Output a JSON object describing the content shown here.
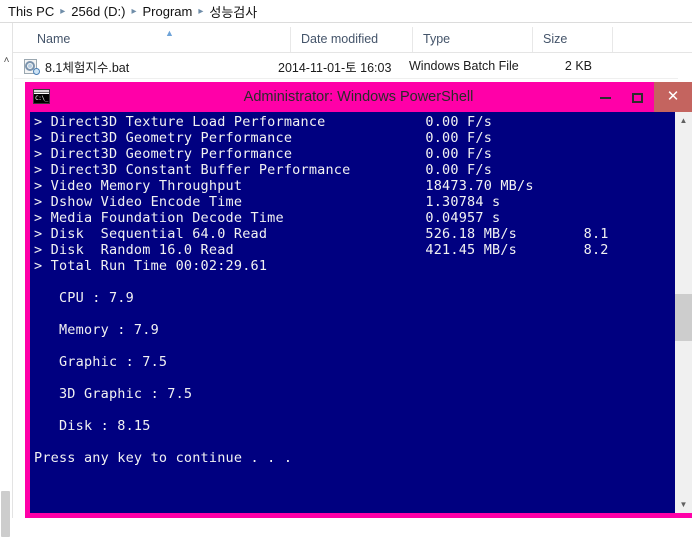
{
  "explorer": {
    "breadcrumb": {
      "name": "address-breadcrumb",
      "separator": "▸",
      "items": [
        "This PC",
        "256d (D:)",
        "Program",
        "성능검사"
      ]
    },
    "columns": {
      "name": "Name",
      "date_modified": "Date modified",
      "type": "Type",
      "size": "Size",
      "sort_glyph": "▲"
    },
    "nav": {
      "collapse_glyph": "˄"
    },
    "files": [
      {
        "name": "8.1체험지수.bat",
        "date_modified": "2014-11-01-토 16:03",
        "type": "Windows Batch File",
        "size": "2 KB",
        "icon": "batch-file-icon"
      }
    ]
  },
  "powershell": {
    "title": "Administrator: Windows PowerShell",
    "icon_label": "C:\\_",
    "controls": {
      "minimize": "–",
      "maximize": "□",
      "close": "✕"
    },
    "colors": {
      "titlebar": "#ff00a8",
      "console_bg": "#000080",
      "console_fg": "#f2f2f2",
      "close_button": "#c4645f"
    },
    "scrollbar": {
      "up_glyph": "▲",
      "down_glyph": "▼"
    },
    "console_lines": [
      "> Direct3D Texture Load Performance            0.00 F/s",
      "> Direct3D Geometry Performance                0.00 F/s",
      "> Direct3D Geometry Performance                0.00 F/s",
      "> Direct3D Constant Buffer Performance         0.00 F/s",
      "> Video Memory Throughput                      18473.70 MB/s",
      "> Dshow Video Encode Time                      1.30784 s",
      "> Media Foundation Decode Time                 0.04957 s",
      "> Disk  Sequential 64.0 Read                   526.18 MB/s        8.1",
      "> Disk  Random 16.0 Read                       421.45 MB/s        8.2",
      "> Total Run Time 00:02:29.61",
      "",
      "   CPU : 7.9",
      "",
      "   Memory : 7.9",
      "",
      "   Graphic : 7.5",
      "",
      "   3D Graphic : 7.5",
      "",
      "   Disk : 8.15",
      "",
      "Press any key to continue . . ."
    ],
    "benchmark_results": [
      {
        "metric": "Direct3D Texture Load Performance",
        "value": "0.00 F/s",
        "score": ""
      },
      {
        "metric": "Direct3D Geometry Performance",
        "value": "0.00 F/s",
        "score": ""
      },
      {
        "metric": "Direct3D Geometry Performance",
        "value": "0.00 F/s",
        "score": ""
      },
      {
        "metric": "Direct3D Constant Buffer Performance",
        "value": "0.00 F/s",
        "score": ""
      },
      {
        "metric": "Video Memory Throughput",
        "value": "18473.70 MB/s",
        "score": ""
      },
      {
        "metric": "Dshow Video Encode Time",
        "value": "1.30784 s",
        "score": ""
      },
      {
        "metric": "Media Foundation Decode Time",
        "value": "0.04957 s",
        "score": ""
      },
      {
        "metric": "Disk  Sequential 64.0 Read",
        "value": "526.18 MB/s",
        "score": "8.1"
      },
      {
        "metric": "Disk  Random 16.0 Read",
        "value": "421.45 MB/s",
        "score": "8.2"
      }
    ],
    "total_run_time": "00:02:29.61",
    "scores": [
      {
        "label": "CPU",
        "value": "7.9"
      },
      {
        "label": "Memory",
        "value": "7.9"
      },
      {
        "label": "Graphic",
        "value": "7.5"
      },
      {
        "label": "3D Graphic",
        "value": "7.5"
      },
      {
        "label": "Disk",
        "value": "8.15"
      }
    ],
    "prompt": "Press any key to continue . . ."
  }
}
